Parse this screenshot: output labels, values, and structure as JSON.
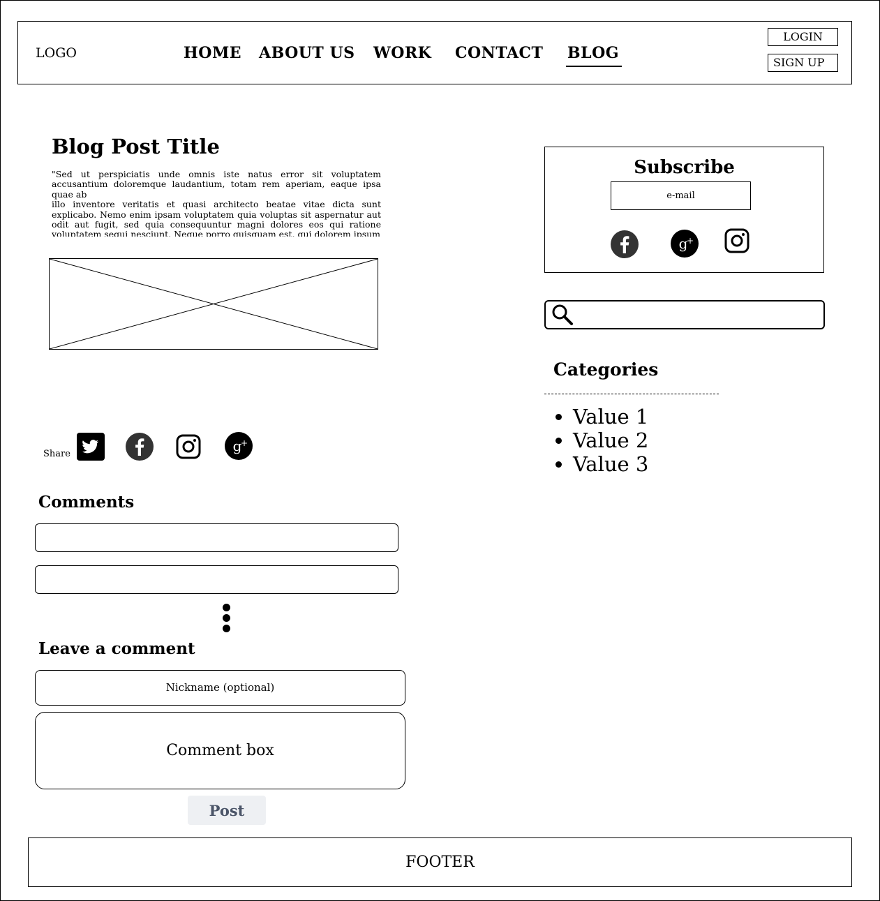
{
  "header": {
    "logo": "LOGO",
    "nav": [
      "HOME",
      "ABOUT US",
      "WORK",
      "CONTACT",
      "BLOG"
    ],
    "active_nav": "BLOG",
    "login_label": "LOGIN",
    "signup_label": "SIGN UP"
  },
  "post": {
    "title": "Blog Post Title",
    "body": "\"Sed ut perspiciatis unde omnis iste natus error sit voluptatem accusantium doloremque laudantium, totam rem aperiam, eaque ipsa quae ab\nillo inventore veritatis et quasi architecto beatae vitae dicta sunt explicabo. Nemo enim ipsam voluptatem quia voluptas sit aspernatur aut odit aut fugit, sed quia consequuntur magni dolores eos qui ratione voluptatem sequi nesciunt. Neque porro quisquam est, qui dolorem ipsum"
  },
  "share": {
    "label": "Share",
    "icons": [
      "twitter-icon",
      "facebook-icon",
      "instagram-icon",
      "google-plus-icon"
    ]
  },
  "comments": {
    "title": "Comments"
  },
  "leave_comment": {
    "title": "Leave a comment",
    "nickname_placeholder": "Nickname (optional)",
    "comment_placeholder": "Comment box",
    "post_label": "Post"
  },
  "subscribe": {
    "title": "Subscribe",
    "email_placeholder": "e-mail",
    "icons": [
      "facebook-icon",
      "google-plus-icon",
      "instagram-icon"
    ]
  },
  "search": {
    "icon": "search-icon"
  },
  "categories": {
    "title": "Categories",
    "items": [
      "Value 1",
      "Value 2",
      "Value 3"
    ]
  },
  "footer": {
    "label": "FOOTER"
  },
  "colors": {
    "post_button_bg": "#eef0f3",
    "post_button_text": "#4b5568",
    "dark_icon": "#333333"
  }
}
